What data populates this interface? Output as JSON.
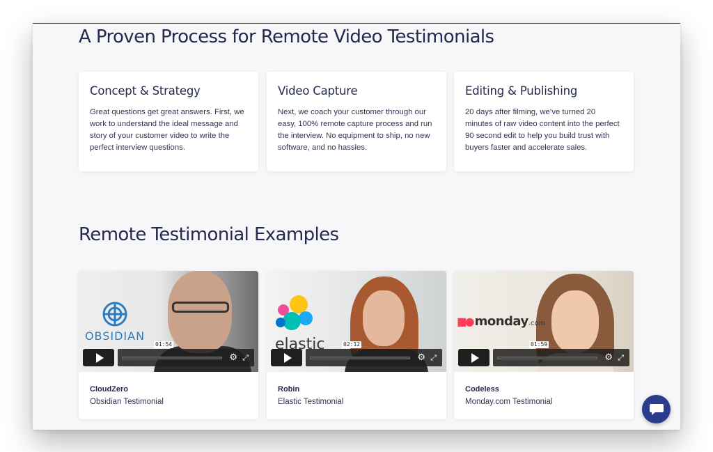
{
  "section_process": {
    "title": "A Proven Process for Remote Video Testimonials",
    "cards": [
      {
        "title": "Concept & Strategy",
        "body": "Great questions get great answers. First, we work to understand the ideal message and story of your customer video to write the perfect interview questions."
      },
      {
        "title": "Video Capture",
        "body": "Next, we coach your customer through our easy, 100% remote capture process and run the interview. No equipment to ship, no new software, and no hassles."
      },
      {
        "title": "Editing & Publishing",
        "body": "20 days after filming, we’ve turned 20 minutes of raw video content into the perfect 90 second edit to help you build trust with buyers faster and accelerate sales."
      }
    ]
  },
  "section_examples": {
    "title": "Remote Testimonial Examples",
    "videos": [
      {
        "company": "CloudZero",
        "caption": "Obsidian Testimonial",
        "duration": "01:54",
        "logo_text": "OBSIDIAN",
        "logo_color": "#2c7cc1"
      },
      {
        "company": "Robin",
        "caption": "Elastic Testimonial",
        "duration": "02:12",
        "logo_text": "elastic",
        "logo_color": "#343741"
      },
      {
        "company": "Codeless",
        "caption": "Monday.com Testimonial",
        "duration": "01:59",
        "logo_text": "monday",
        "logo_suffix": ".com",
        "logo_color": "#ff3d57"
      }
    ]
  },
  "icons": {
    "play": "play-icon",
    "settings": "gear-icon",
    "fullscreen": "fullscreen-icon",
    "chat": "chat-icon"
  },
  "colors": {
    "heading": "#232a4d",
    "page_background": "#f7f7fa",
    "chat_button": "#2b3c8c"
  }
}
